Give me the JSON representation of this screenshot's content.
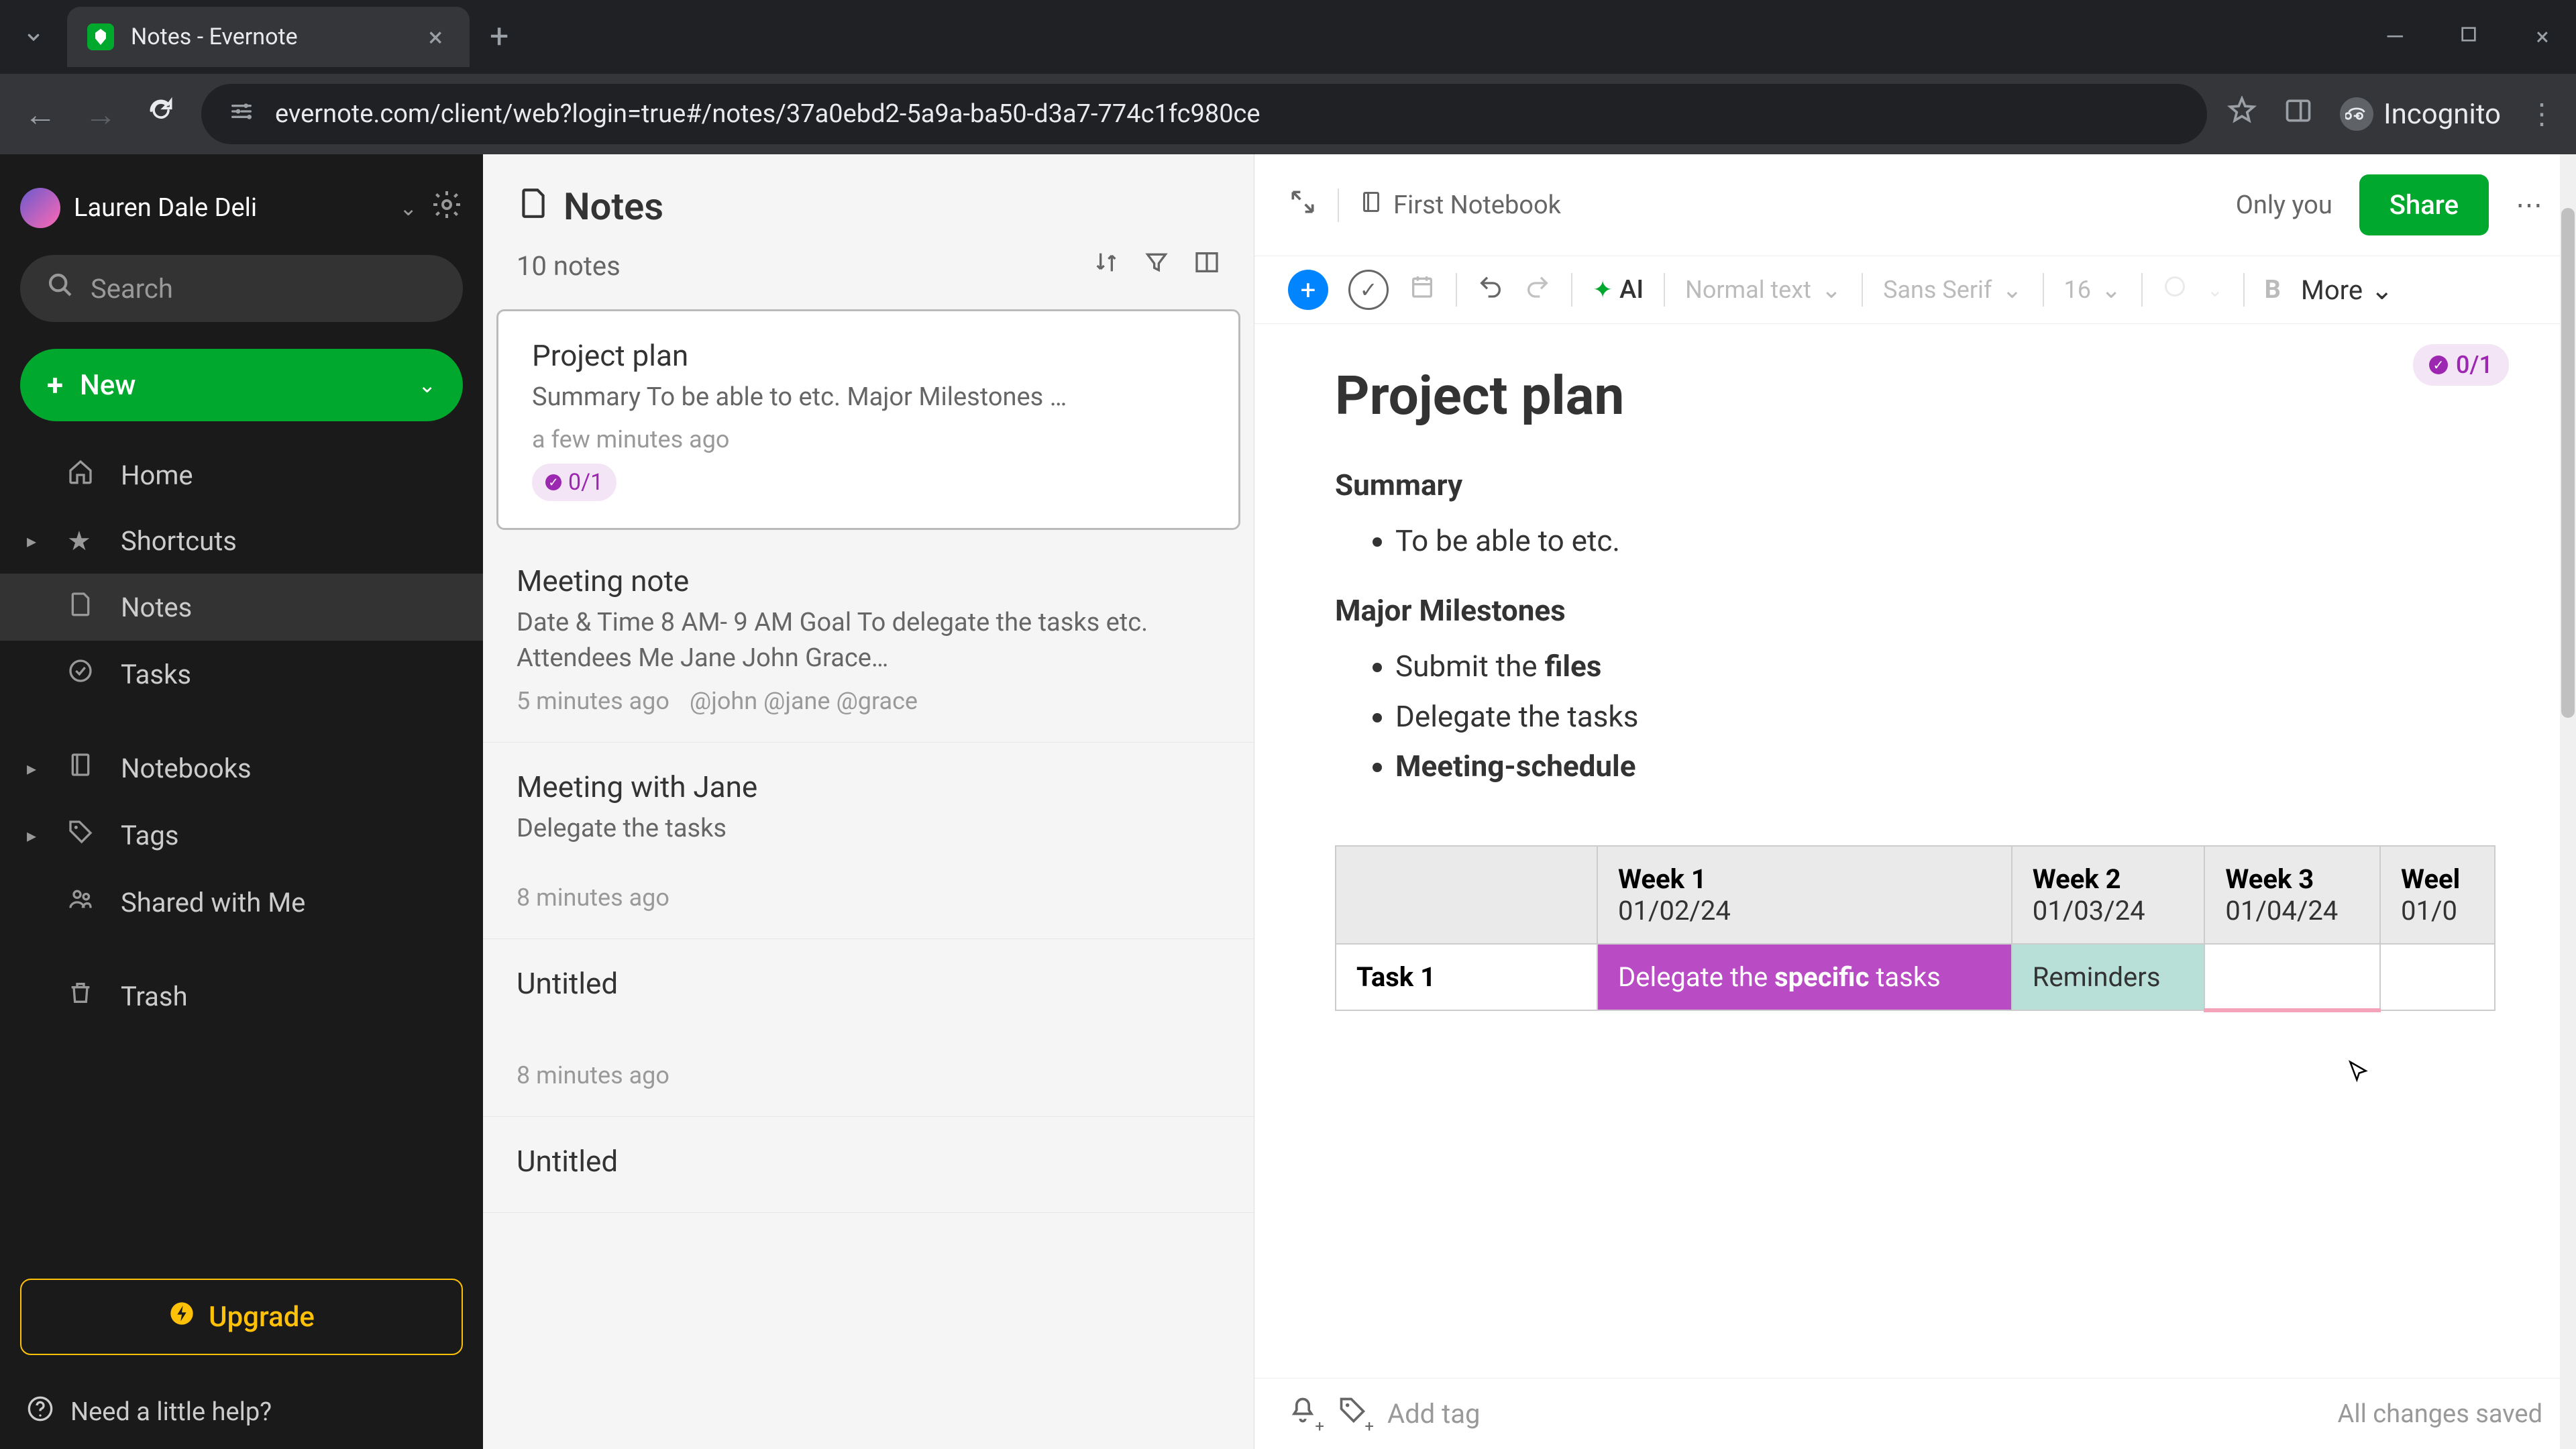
{
  "browser": {
    "tab_title": "Notes - Evernote",
    "url": "evernote.com/client/web?login=true#/notes/37a0ebd2-5a9a-ba50-d3a7-774c1fc980ce",
    "incognito_label": "Incognito"
  },
  "sidebar": {
    "user_name": "Lauren Dale Deli",
    "search_placeholder": "Search",
    "new_label": "New",
    "nav": {
      "home": "Home",
      "shortcuts": "Shortcuts",
      "notes": "Notes",
      "tasks": "Tasks",
      "notebooks": "Notebooks",
      "tags": "Tags",
      "shared": "Shared with Me",
      "trash": "Trash"
    },
    "upgrade": "Upgrade",
    "help": "Need a little help?"
  },
  "notes_list": {
    "title": "Notes",
    "count": "10 notes",
    "items": [
      {
        "title": "Project plan",
        "preview": "Summary To be able to etc. Major Milestones …",
        "time": "a few minutes ago",
        "badge": "0/1"
      },
      {
        "title": "Meeting note",
        "preview": "Date & Time 8 AM- 9 AM Goal To delegate the tasks etc. Attendees Me Jane John Grace…",
        "time": "5 minutes ago",
        "mentions": "@john @jane @grace"
      },
      {
        "title": "Meeting with Jane",
        "preview": "Delegate the tasks",
        "time": "8 minutes ago"
      },
      {
        "title": "Untitled",
        "preview": "",
        "time": "8 minutes ago"
      },
      {
        "title": "Untitled",
        "preview": "",
        "time": ""
      }
    ]
  },
  "editor": {
    "notebook": "First Notebook",
    "only_you": "Only you",
    "share": "Share",
    "toolbar": {
      "ai": "AI",
      "style": "Normal text",
      "font": "Sans Serif",
      "size": "16",
      "more": "More"
    },
    "task_badge": "0/1",
    "title": "Project plan",
    "sections": {
      "summary_heading": "Summary",
      "summary_item": "To be able to etc.",
      "milestones_heading": "Major Milestones",
      "milestone_1_pre": "Submit the ",
      "milestone_1_bold": "files",
      "milestone_2": "Delegate the tasks",
      "milestone_3": "Meeting-schedule"
    },
    "table": {
      "weeks": [
        {
          "label": "Week 1",
          "date": "01/02/24"
        },
        {
          "label": "Week 2",
          "date": "01/03/24"
        },
        {
          "label": "Week 3",
          "date": "01/04/24"
        },
        {
          "label": "Weel",
          "date": "01/0"
        }
      ],
      "row_label": "Task 1",
      "cell_purple_pre": "Delegate the ",
      "cell_purple_bold": "specific",
      "cell_purple_post": " tasks",
      "cell_teal": "Reminders"
    },
    "add_tag": "Add tag",
    "save_status": "All changes saved"
  }
}
